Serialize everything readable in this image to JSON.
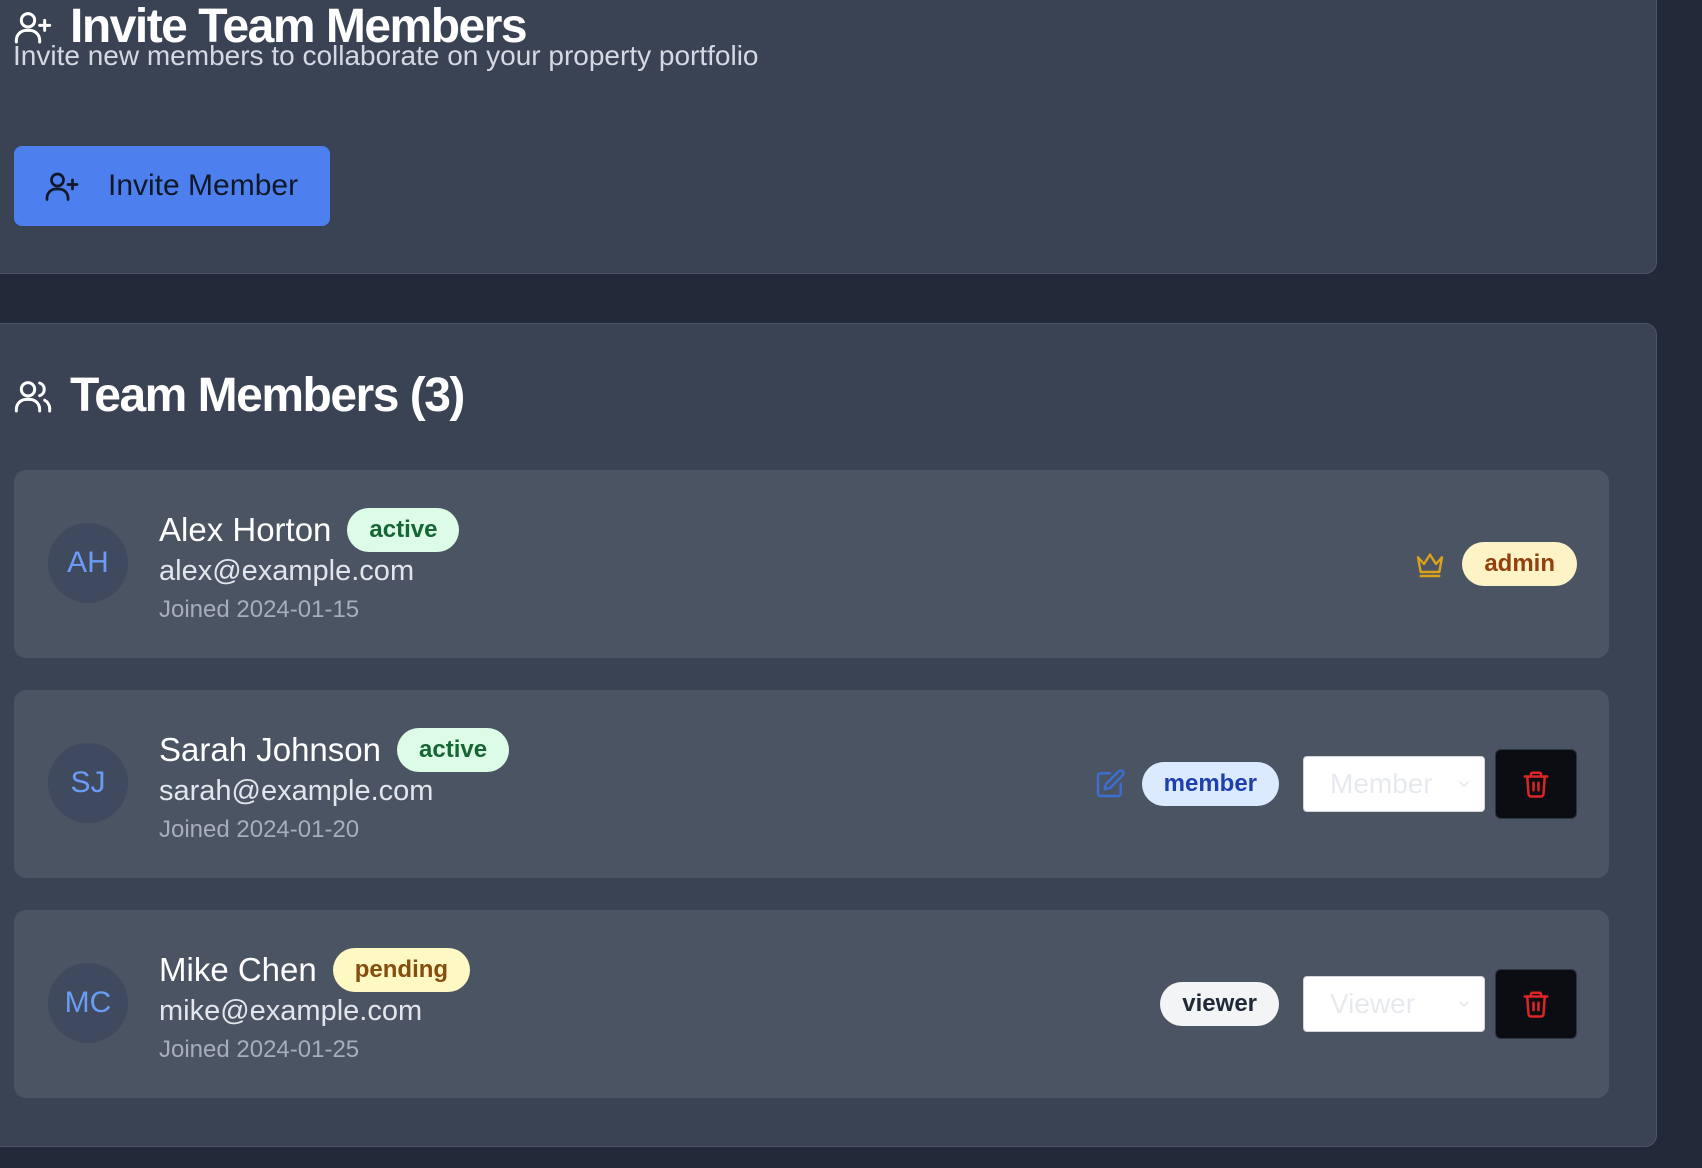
{
  "invite": {
    "title": "Invite Team Members",
    "subtitle": "Invite new members to collaborate on your property portfolio",
    "button_label": "Invite Member"
  },
  "team": {
    "title": "Team Members (3)",
    "members": [
      {
        "initials": "AH",
        "name": "Alex Horton",
        "status": "active",
        "email": "alex@example.com",
        "joined": "Joined 2024-01-15",
        "role": "admin",
        "role_icon": "crown-icon"
      },
      {
        "initials": "SJ",
        "name": "Sarah Johnson",
        "status": "active",
        "email": "sarah@example.com",
        "joined": "Joined 2024-01-20",
        "role": "member",
        "role_icon": "edit-icon",
        "select_value": "Member"
      },
      {
        "initials": "MC",
        "name": "Mike Chen",
        "status": "pending",
        "email": "mike@example.com",
        "joined": "Joined 2024-01-25",
        "role": "viewer",
        "select_value": "Viewer"
      }
    ]
  },
  "colors": {
    "background": "#222a3a",
    "card": "#3a4354",
    "row": "#4b5462",
    "primary_button": "#4d80ee",
    "avatar_text": "#6b9cf5",
    "crown": "#d9a21b",
    "edit_icon": "#3b6fd6",
    "trash_icon": "#dc2626"
  }
}
